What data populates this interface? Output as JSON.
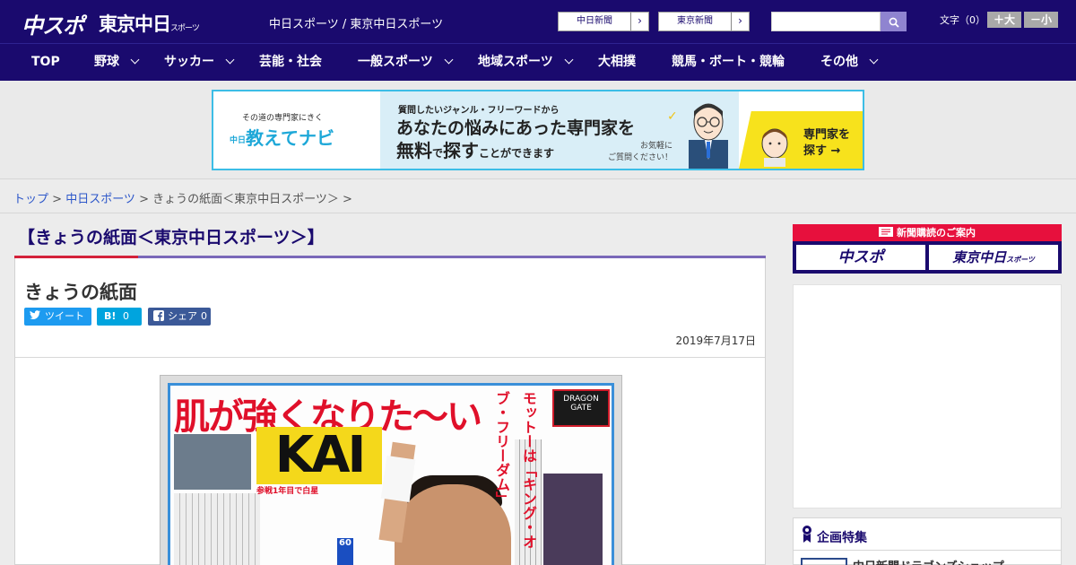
{
  "header": {
    "logo_chuspo": "中スポ",
    "logo_tokyo": "東京中日",
    "logo_tokyo_small": "スポーツ",
    "site_links": "中日スポーツ / 東京中日スポーツ",
    "buttons": [
      {
        "label": "中日新聞",
        "arrow": "›"
      },
      {
        "label": "東京新聞",
        "arrow": "›"
      }
    ],
    "search_placeholder": "",
    "font_label": "文字（0）",
    "font_plus": "＋大",
    "font_minus": "－小"
  },
  "nav": {
    "items": [
      {
        "label": "TOP",
        "has_menu": false
      },
      {
        "label": "野球",
        "has_menu": true
      },
      {
        "label": "サッカー",
        "has_menu": true
      },
      {
        "label": "芸能・社会",
        "has_menu": false
      },
      {
        "label": "一般スポーツ",
        "has_menu": true
      },
      {
        "label": "地域スポーツ",
        "has_menu": true
      },
      {
        "label": "大相撲",
        "has_menu": false
      },
      {
        "label": "競馬・ボート・競輪",
        "has_menu": false
      },
      {
        "label": "その他",
        "has_menu": true
      }
    ]
  },
  "ad": {
    "tagline": "その道の専門家にきく",
    "brand_prefix": "中日",
    "brand": "教えてナビ",
    "line1": "質問したいジャンル・フリーワードから",
    "line2": "あなたの悩みにあった専門家を",
    "line3_a": "無料",
    "line3_b": "で",
    "line3_c": "探す",
    "line3_d": "ことができます",
    "small": "お気軽に\nご質問ください！",
    "cta_line1": "専門家を",
    "cta_line2": "探す →"
  },
  "breadcrumb": {
    "top": "トップ",
    "sep": " > ",
    "chunichi": "中日スポーツ",
    "current": "きょうの紙面＜東京中日スポーツ＞"
  },
  "article": {
    "heading": "【きょうの紙面＜東京中日スポーツ＞】",
    "title": "きょうの紙面",
    "tweet_label": "ツイート",
    "hatena_label": "B!",
    "hatena_count": "0",
    "share_label": "シェア",
    "share_count": "0",
    "date": "2019年7月17日"
  },
  "newspaper": {
    "headline": "肌が強くなりた〜い",
    "name": "KAI",
    "vertical_1": "モットーは「キング・オブ・フリーダム」",
    "vertical_2": "",
    "sub": "参戦1年目で白星",
    "badge": "60"
  },
  "sidebar": {
    "subscribe_label": "新聞購読のご案内",
    "sub_btn_1": "中スポ",
    "sub_btn_2": "東京中日",
    "sub_btn_2_small": "スポーツ",
    "feature_title": "企画特集",
    "feature_item": "中日新聞ドラゴンズショップ"
  },
  "colors": {
    "brand_navy": "#1a0a6e",
    "accent_red": "#e7103d",
    "link_blue": "#2c56c9",
    "twitter": "#1d9bf0"
  }
}
